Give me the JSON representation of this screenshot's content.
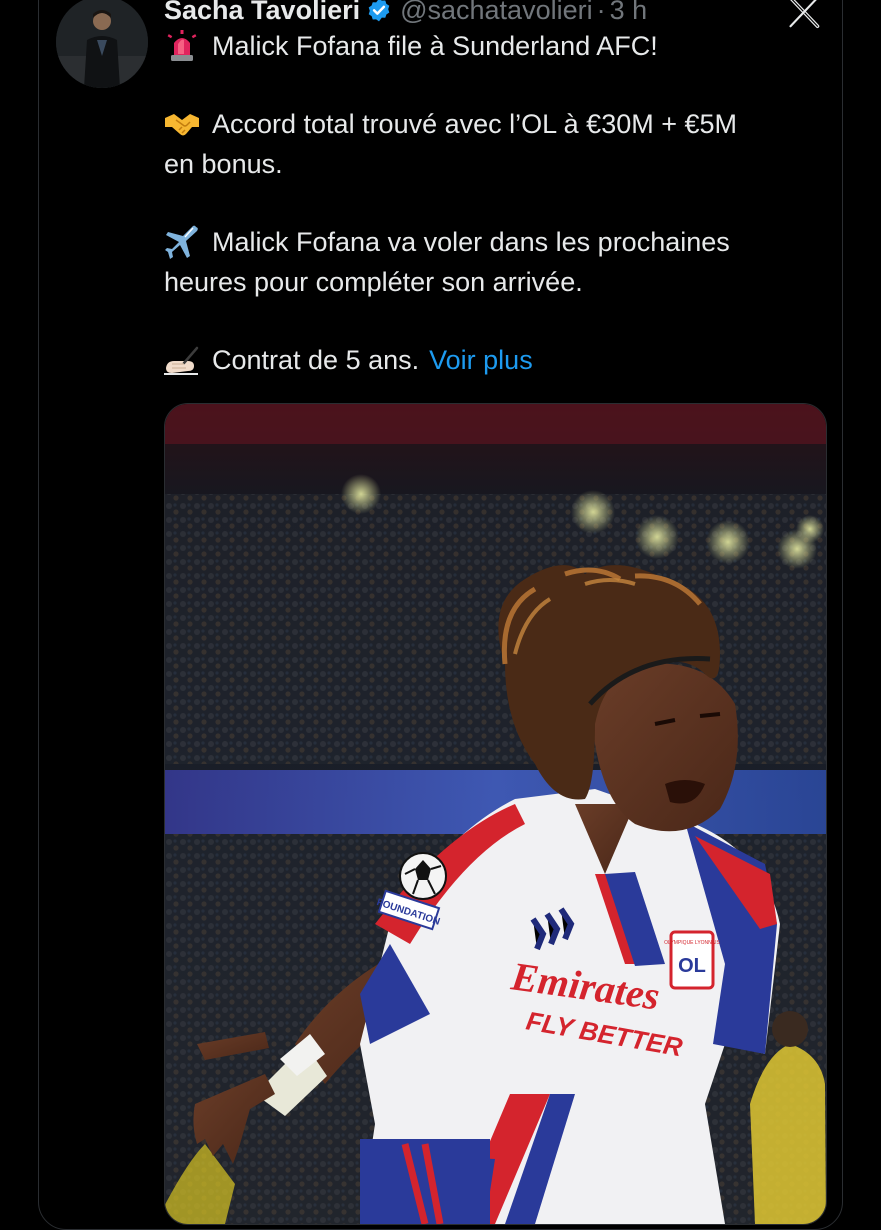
{
  "tweet": {
    "author_name": "Sacha Tavolieri",
    "handle": "@sachatavolieri",
    "separator": "·",
    "time": "3 h",
    "lines": [
      "Malick Fofana file à Sunderland AFC!",
      "Accord total trouvé avec l’OL à €30M + €5M",
      "en bonus.",
      "Malick Fofana va voler dans les prochaines",
      "heures pour compléter son arrivée.",
      "Contrat de 5 ans."
    ],
    "see_more": "Voir plus",
    "icons": {
      "verified": "verified-badge-icon",
      "siren": "rotating-light-emoji",
      "handshake": "handshake-emoji",
      "airplane": "airplane-emoji",
      "writing": "writing-hand-emoji",
      "brand": "x-logo-icon"
    },
    "photo_text": {
      "sponsor": "Emirates",
      "slogan": "FLY BETTER",
      "crest": "OL",
      "crest_top": "OLYMPIQUE LYONNAIS",
      "badge": "FOUNDATION"
    }
  },
  "colors": {
    "background": "#000000",
    "text": "#e7e9ea",
    "secondary": "#71767b",
    "link": "#1d9bf0",
    "verified": "#1d9bf0"
  }
}
